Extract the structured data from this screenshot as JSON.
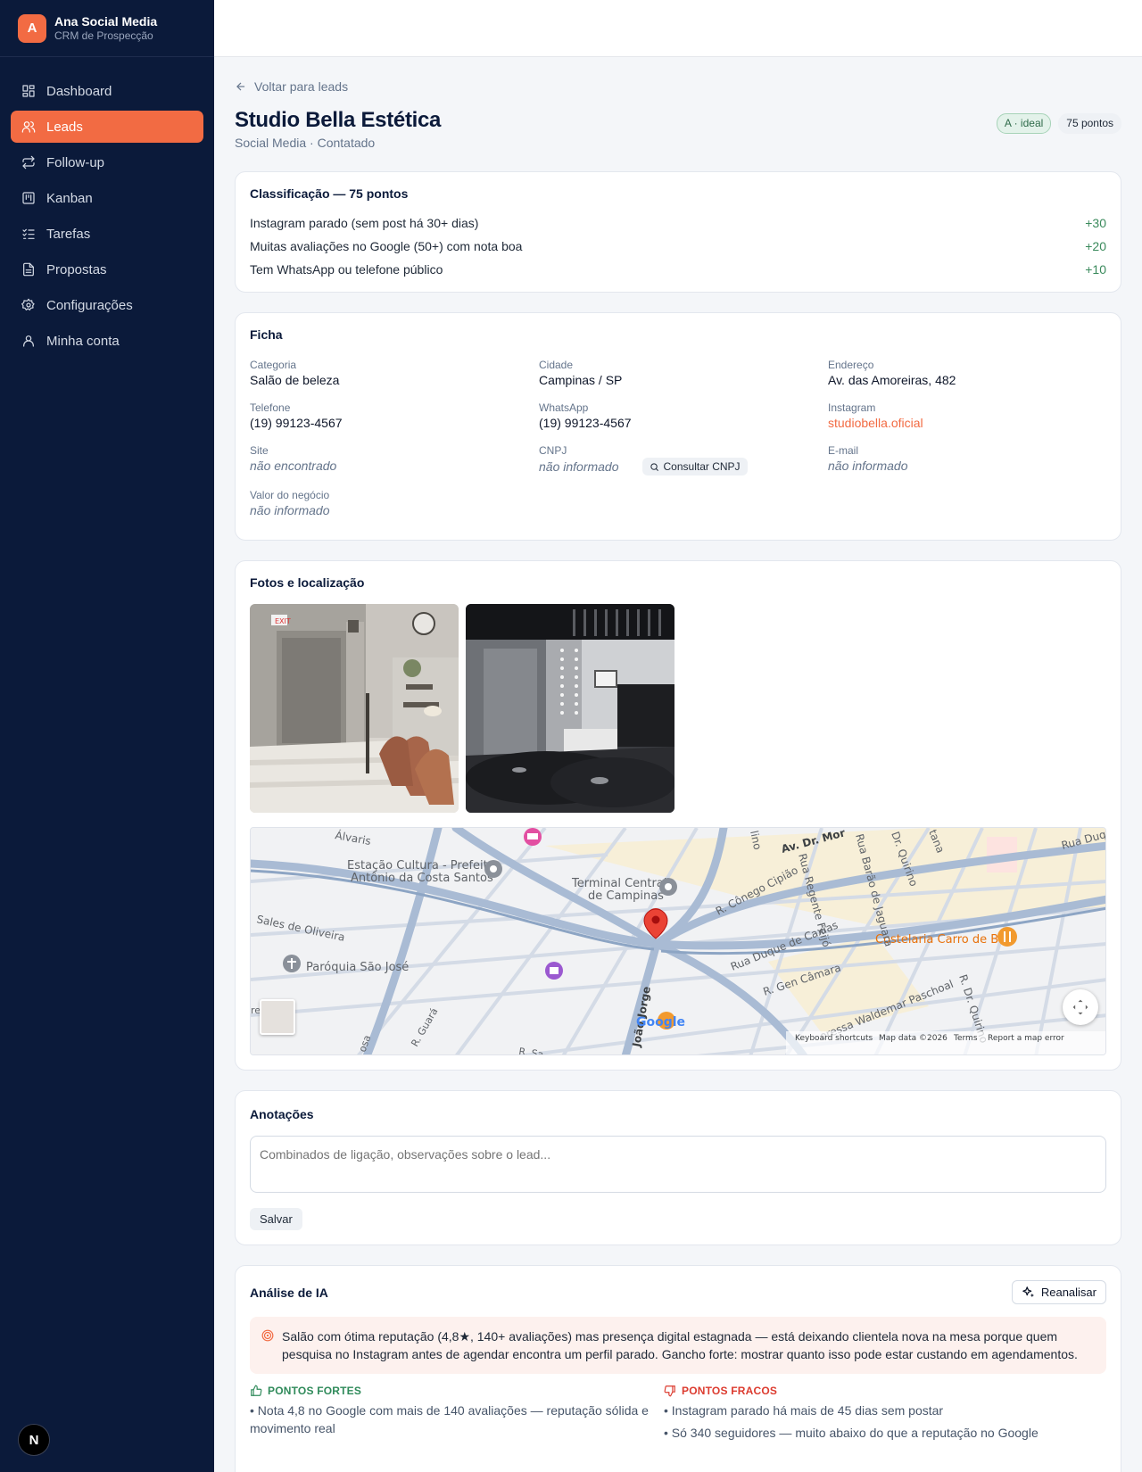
{
  "brand": {
    "initial": "A",
    "name": "Ana Social Media",
    "subtitle": "CRM de Prospecção"
  },
  "nav": [
    {
      "label": "Dashboard",
      "icon": "dashboard-icon",
      "active": false
    },
    {
      "label": "Leads",
      "icon": "users-icon",
      "active": true
    },
    {
      "label": "Follow-up",
      "icon": "repeat-icon",
      "active": false
    },
    {
      "label": "Kanban",
      "icon": "kanban-icon",
      "active": false
    },
    {
      "label": "Tarefas",
      "icon": "list-checks-icon",
      "active": false
    },
    {
      "label": "Propostas",
      "icon": "file-text-icon",
      "active": false
    },
    {
      "label": "Configurações",
      "icon": "gear-icon",
      "active": false
    },
    {
      "label": "Minha conta",
      "icon": "user-icon",
      "active": false
    }
  ],
  "n_badge": "N",
  "back_label": "Voltar para leads",
  "lead": {
    "title": "Studio Bella Estética",
    "subtitle": "Social Media · Contatado",
    "badge_class": "A · ideal",
    "badge_points": "75 pontos"
  },
  "classificacao": {
    "title": "Classificação — 75 pontos",
    "rows": [
      {
        "label": "Instagram parado (sem post há 30+ dias)",
        "points": "+30"
      },
      {
        "label": "Muitas avaliações no Google (50+) com nota boa",
        "points": "+20"
      },
      {
        "label": "Tem WhatsApp ou telefone público",
        "points": "+10"
      }
    ]
  },
  "ficha": {
    "title": "Ficha",
    "categoria": {
      "label": "Categoria",
      "value": "Salão de beleza"
    },
    "cidade": {
      "label": "Cidade",
      "value": "Campinas / SP"
    },
    "endereco": {
      "label": "Endereço",
      "value": "Av. das Amoreiras, 482"
    },
    "telefone": {
      "label": "Telefone",
      "value": "(19) 99123-4567"
    },
    "whatsapp": {
      "label": "WhatsApp",
      "value": "(19) 99123-4567"
    },
    "instagram": {
      "label": "Instagram",
      "value": "studiobella.oficial"
    },
    "site": {
      "label": "Site",
      "value": "não encontrado"
    },
    "cnpj": {
      "label": "CNPJ",
      "value": "não informado",
      "button": "Consultar CNPJ"
    },
    "email": {
      "label": "E-mail",
      "value": "não informado"
    },
    "valor": {
      "label": "Valor do negócio",
      "value": "não informado"
    }
  },
  "fotos": {
    "title": "Fotos e localização",
    "map": {
      "labels": {
        "estacao": "Estação Cultura - Prefeito",
        "estacao2": "Antônio da Costa Santos",
        "terminal": "Terminal Central",
        "terminal2": "de Campinas",
        "paroquia": "Paróquia São José",
        "costelaria": "Costelaria Carro de Boi",
        "sales": "Sales de Oliveira",
        "conego": "R. Cônego Cipião",
        "duque": "Rua Duque de Caxias",
        "gen": "R. Gen Câmara",
        "waldemar": "oressa Waldemar Paschoal",
        "regente": "Rua Regente Feijó",
        "barao": "Rua Barão de Jaguara",
        "quirino": "Dr. Quirino",
        "quirino2": "R. Dr. Quirino",
        "moraes": "Av. Dr. Mor",
        "joao": "João Jorge",
        "guara": "R. Guará",
        "alvaris": "Álvaris",
        "ruaduq": "Rua Duq",
        "lino": "lino",
        "tana": "tana",
        "rsa": "R. Sa",
        "rosa": "osa",
        "re": "re"
      },
      "google": "Google",
      "footer": [
        "Keyboard shortcuts",
        "Map data ©2026",
        "Terms",
        "Report a map error"
      ]
    }
  },
  "anotacoes": {
    "title": "Anotações",
    "placeholder": "Combinados de ligação, observações sobre o lead...",
    "save": "Salvar"
  },
  "ia": {
    "title": "Análise de IA",
    "button": "Reanalisar",
    "summary": "Salão com ótima reputação (4,8★, 140+ avaliações) mas presença digital estagnada — está deixando clientela nova na mesa porque quem pesquisa no Instagram antes de agendar encontra um perfil parado. Gancho forte: mostrar quanto isso pode estar custando em agendamentos.",
    "fortes_title": "PONTOS FORTES",
    "fortes": [
      "• Nota 4,8 no Google com mais de 140 avaliações — reputação sólida e movimento real"
    ],
    "fracos_title": "PONTOS FRACOS",
    "fracos": [
      "• Instagram parado há mais de 45 dias sem postar",
      "• Só 340 seguidores — muito abaixo do que a reputação no Google"
    ]
  },
  "colors": {
    "sidebar": "#0b1a3a",
    "accent": "#f26b43",
    "positive": "#3a8a5c",
    "negative": "#dc3b2f"
  }
}
